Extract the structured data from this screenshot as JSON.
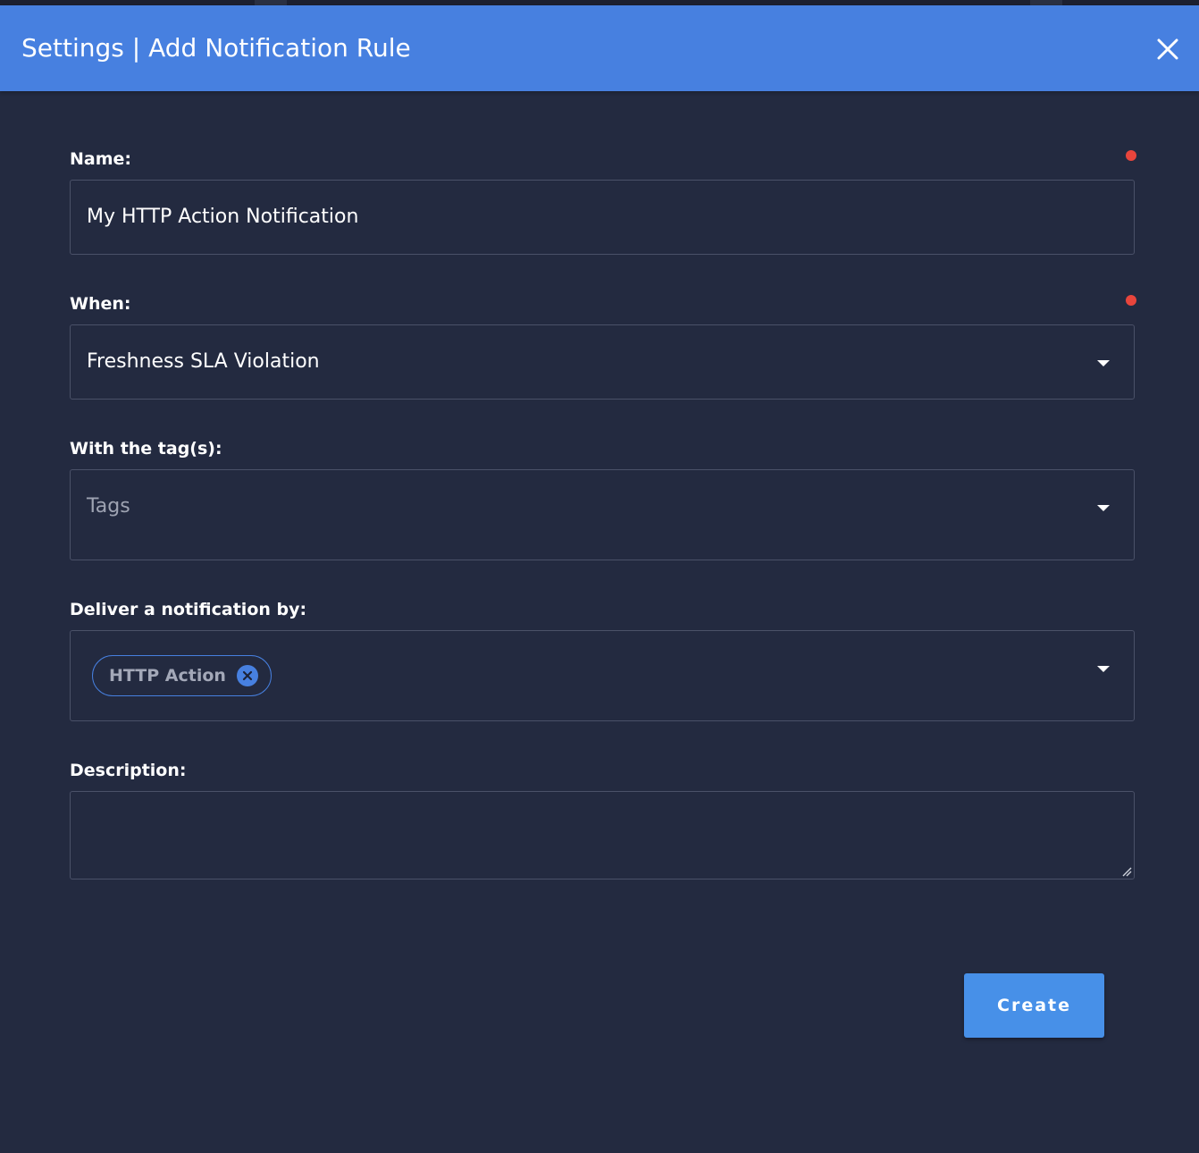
{
  "modal": {
    "title": "Settings | Add Notification Rule",
    "close_icon": "close-icon"
  },
  "form": {
    "name": {
      "label": "Name:",
      "value": "My HTTP Action Notification",
      "required": true
    },
    "when": {
      "label": "When:",
      "selected": "Freshness SLA Violation",
      "required": true
    },
    "tags": {
      "label": "With the tag(s):",
      "placeholder": "Tags"
    },
    "deliver": {
      "label": "Deliver a notification by:",
      "chips": [
        {
          "label": "HTTP Action"
        }
      ]
    },
    "description": {
      "label": "Description:",
      "value": ""
    }
  },
  "actions": {
    "create_label": "Create"
  },
  "colors": {
    "header": "#4780e0",
    "background": "#232a40",
    "border": "#4a5168",
    "required": "#e8453c",
    "button": "#4790e8"
  }
}
